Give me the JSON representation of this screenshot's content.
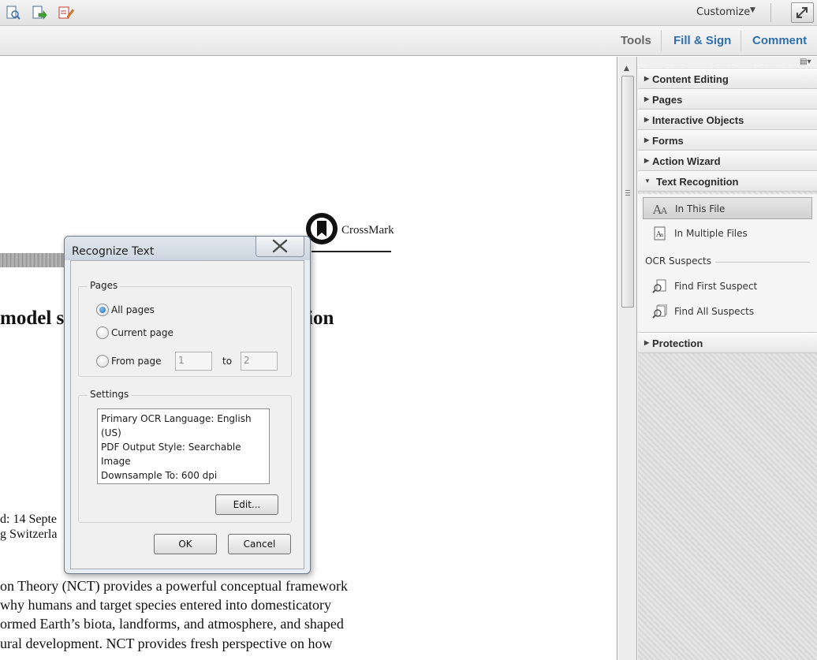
{
  "toolbar": {
    "icons": [
      "page-search-icon",
      "page-export-icon",
      "sign-pen-icon"
    ],
    "customize_label": "Customize",
    "fullscreen_icon": "expand-arrow-icon"
  },
  "tabs": {
    "tools": "Tools",
    "fill_sign": "Fill & Sign",
    "comment": "Comment"
  },
  "document": {
    "crossmark": "CrossMark",
    "heading_left": "model s",
    "heading_right": "ion",
    "date_fragment": "d: 14 Septe",
    "place_fragment": "g Switzerla",
    "body_lines": [
      "on Theory (NCT) provides a powerful conceptual framework",
      "why humans and target species entered into domesticatory",
      "ormed Earth’s biota, landforms, and atmosphere, and shaped",
      "ural development. NCT provides fresh perspective on how"
    ]
  },
  "panel": {
    "sections": {
      "content_editing": "Content Editing",
      "pages": "Pages",
      "interactive_objects": "Interactive Objects",
      "forms": "Forms",
      "action_wizard": "Action Wizard",
      "text_recognition": "Text Recognition",
      "protection": "Protection"
    },
    "text_recognition_items": {
      "in_this_file": "In This File",
      "in_multiple_files": "In Multiple Files",
      "ocr_suspects": "OCR Suspects",
      "find_first_suspect": "Find First Suspect",
      "find_all_suspects": "Find All Suspects"
    }
  },
  "dialog": {
    "title": "Recognize Text",
    "pages_group": "Pages",
    "all_pages": "All pages",
    "current_page": "Current page",
    "from_page": "From page",
    "from_value": "1",
    "to_label": "to",
    "to_value": "2",
    "selected_option": "All pages",
    "settings_group": "Settings",
    "settings_lines": [
      "Primary OCR Language: English (US)",
      "PDF Output Style: Searchable Image",
      "Downsample To: 600 dpi"
    ],
    "edit_button": "Edit...",
    "ok_button": "OK",
    "cancel_button": "Cancel"
  },
  "colors": {
    "tab_accent": "#2f6fae",
    "radio_selected": "#1d6fae"
  }
}
